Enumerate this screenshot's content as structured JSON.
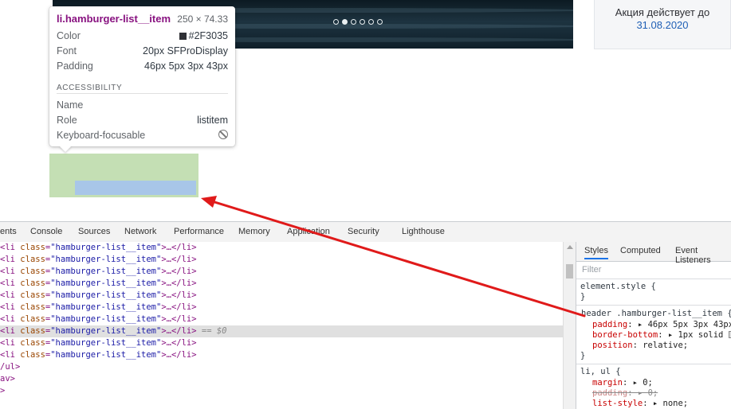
{
  "promo": {
    "text": "Акция действует до",
    "date": "31.08.2020"
  },
  "tooltip": {
    "selector": "li.hamburger-list__item",
    "dimensions": "250 × 74.33",
    "color_label": "Color",
    "color_value": "#2F3035",
    "font_label": "Font",
    "font_value": "20px SFProDisplay",
    "padding_label": "Padding",
    "padding_value": "46px 5px 3px 43px",
    "section": "ACCESSIBILITY",
    "name_label": "Name",
    "name_value": "",
    "role_label": "Role",
    "role_value": "listitem",
    "keyboard_label": "Keyboard-focusable",
    "keyboard_icon": "not-focusable-icon"
  },
  "devtools": {
    "tabs": [
      "ents",
      "Console",
      "Sources",
      "Network",
      "Performance",
      "Memory",
      "Application",
      "Security",
      "Lighthouse"
    ],
    "dom_lines": [
      {
        "open": "<li ",
        "attr": "class",
        "eq": "=",
        "val": "\"hamburger-list__item\"",
        "close": ">…</li>",
        "suffix": ""
      },
      {
        "open": "<li ",
        "attr": "class",
        "eq": "=",
        "val": "\"hamburger-list__item\"",
        "close": ">…</li>",
        "suffix": ""
      },
      {
        "open": "<li ",
        "attr": "class",
        "eq": "=",
        "val": "\"hamburger-list__item\"",
        "close": ">…</li>",
        "suffix": ""
      },
      {
        "open": "<li ",
        "attr": "class",
        "eq": "=",
        "val": "\"hamburger-list__item\"",
        "close": ">…</li>",
        "suffix": ""
      },
      {
        "open": "<li ",
        "attr": "class",
        "eq": "=",
        "val": "\"hamburger-list__item\"",
        "close": ">…</li>",
        "suffix": ""
      },
      {
        "open": "<li ",
        "attr": "class",
        "eq": "=",
        "val": "\"hamburger-list__item\"",
        "close": ">…</li>",
        "suffix": ""
      },
      {
        "open": "<li ",
        "attr": "class",
        "eq": "=",
        "val": "\"hamburger-list__item\"",
        "close": ">…</li>",
        "suffix": ""
      },
      {
        "open": "<li ",
        "attr": "class",
        "eq": "=",
        "val": "\"hamburger-list__item\"",
        "close": ">…</li>",
        "suffix": " == $0"
      },
      {
        "open": "<li ",
        "attr": "class",
        "eq": "=",
        "val": "\"hamburger-list__item\"",
        "close": ">…</li>",
        "suffix": ""
      },
      {
        "open": "<li ",
        "attr": "class",
        "eq": "=",
        "val": "\"hamburger-list__item\"",
        "close": ">…</li>",
        "suffix": ""
      }
    ],
    "dom_tail": [
      "/ul>",
      "av>",
      ">"
    ],
    "selected_index": 7,
    "styles_tabs": [
      "Styles",
      "Computed",
      "Event Listeners"
    ],
    "filter_placeholder": "Filter",
    "rule0_selector": "element.style {",
    "rule0_close": "}",
    "rule1_selector": "header .hamburger-list__item {",
    "rule1_p1_name": "padding",
    "rule1_p1_value": "46px 5px 3px 43px;",
    "rule1_p2_name": "border-bottom",
    "rule1_p2_value": "1px solid ",
    "rule1_p2_cut": "r",
    "rule1_p3_name": "position",
    "rule1_p3_value": "relative;",
    "rule1_close": "}",
    "rule2_selector": "li, ul {",
    "rule2_p1_name": "margin",
    "rule2_p1_value": "0;",
    "rule2_p2_name": "padding",
    "rule2_p2_value": "0;",
    "rule2_p3_name": "list-style",
    "rule2_p3_value": "none;"
  },
  "colors": {
    "annotation_arrow": "#e01a1a",
    "highlight_margin": "#c4dfb4",
    "highlight_content": "#a8c6e8"
  }
}
